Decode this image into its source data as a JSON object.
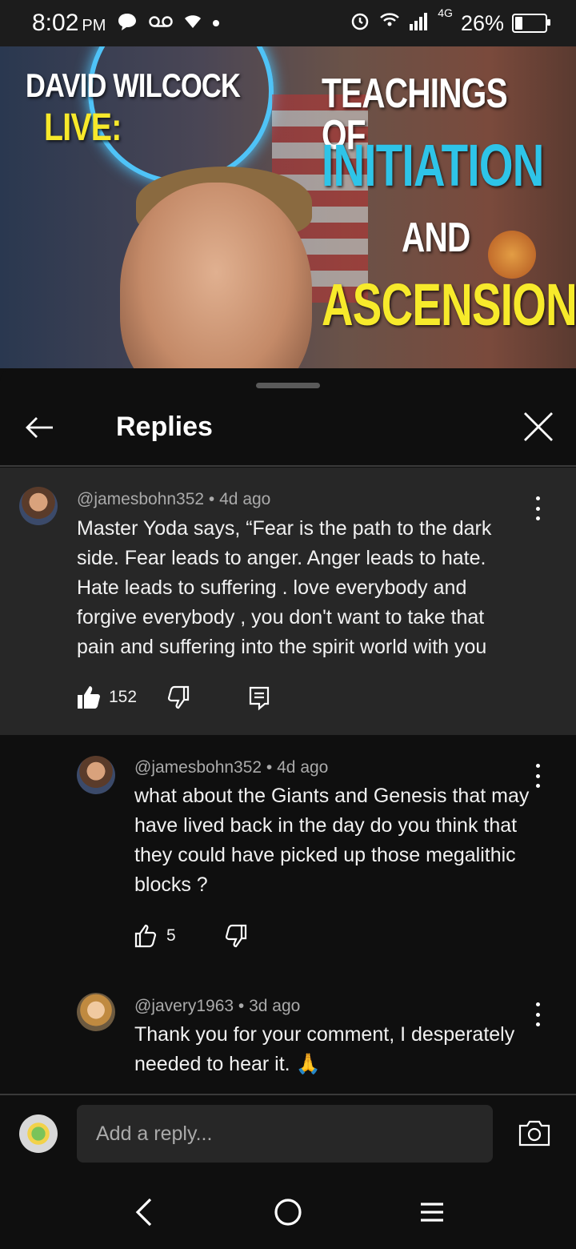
{
  "status": {
    "time": "8:02",
    "ampm": "PM",
    "network": "4G",
    "battery": "26%",
    "battery_level": 0.26
  },
  "video": {
    "line1": "DAVID WILCOCK",
    "line2": "LIVE:",
    "line3": "TEACHINGS OF",
    "line4": "INITIATION",
    "line5": "AND",
    "line6": "ASCENSION"
  },
  "panel": {
    "title": "Replies"
  },
  "parent_comment": {
    "author": "@jamesbohn352",
    "age": "4d ago",
    "text": "Master Yoda says, “Fear is the path to the dark side. Fear leads to anger. Anger leads to hate. Hate leads to suffering . love everybody and forgive everybody , you don't want to take that pain and suffering into the spirit world with you",
    "likes": "152"
  },
  "replies": [
    {
      "author": "@jamesbohn352",
      "age": "4d ago",
      "text": "what about the Giants and Genesis that may have lived back in the day do you think that they could have picked up those megalithic blocks ?",
      "likes": "5"
    },
    {
      "author": "@javery1963",
      "age": "3d ago",
      "text": "Thank you for your comment, I desperately needed to hear it. 🙏"
    }
  ],
  "reply_input": {
    "placeholder": "Add a reply..."
  },
  "colors": {
    "background": "#0f0f0f",
    "surface": "#272727",
    "accent_cyan": "#2ec4e8",
    "accent_yellow": "#f7ea2b"
  }
}
